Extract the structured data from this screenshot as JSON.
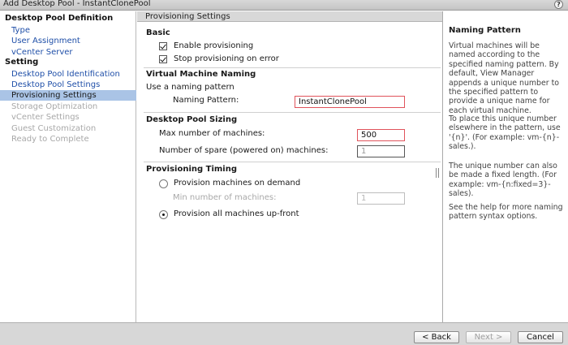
{
  "window": {
    "title": "Add Desktop Pool - InstantClonePool",
    "help_glyph": "?"
  },
  "sidebar": {
    "sections": [
      {
        "heading": "Desktop Pool Definition",
        "items": [
          {
            "label": "Type",
            "state": "link"
          },
          {
            "label": "User Assignment",
            "state": "link"
          },
          {
            "label": "vCenter Server",
            "state": "link"
          }
        ]
      },
      {
        "heading": "Setting",
        "items": [
          {
            "label": "Desktop Pool Identification",
            "state": "link"
          },
          {
            "label": "Desktop Pool Settings",
            "state": "link"
          },
          {
            "label": "Provisioning Settings",
            "state": "active"
          },
          {
            "label": "Storage Optimization",
            "state": "disabled"
          },
          {
            "label": "vCenter Settings",
            "state": "disabled"
          },
          {
            "label": "Guest Customization",
            "state": "disabled"
          },
          {
            "label": "Ready to Complete",
            "state": "disabled"
          }
        ]
      }
    ]
  },
  "main": {
    "header": "Provisioning Settings",
    "basic": {
      "title": "Basic",
      "enable_provisioning": {
        "label": "Enable provisioning",
        "checked": true
      },
      "stop_on_error": {
        "label": "Stop provisioning on error",
        "checked": true
      }
    },
    "naming": {
      "title": "Virtual Machine Naming",
      "use_pattern_label": "Use a naming pattern",
      "pattern_label": "Naming Pattern:",
      "pattern_value": "InstantClonePool"
    },
    "sizing": {
      "title": "Desktop Pool Sizing",
      "max_label": "Max number of machines:",
      "max_value": "500",
      "spare_label": "Number of spare (powered on) machines:",
      "spare_value": "1"
    },
    "timing": {
      "title": "Provisioning Timing",
      "on_demand_label": "Provision machines on demand",
      "min_label": "Min number of machines:",
      "min_value": "1",
      "upfront_label": "Provision all machines up-front",
      "selected": "upfront"
    }
  },
  "help": {
    "title": "Naming Pattern",
    "paragraphs": [
      "Virtual machines will be named according to the specified naming pattern. By default, View Manager appends a unique number to the specified pattern to provide a unique name for each virtual machine.",
      "To place this unique number elsewhere in the pattern, use '{n}'. (For example: vm-{n}-sales.).",
      "The unique number can also be made a fixed length. (For example: vm-{n:fixed=3}-sales).",
      "See the help for more naming pattern syntax options."
    ]
  },
  "footer": {
    "back_label": "< Back",
    "next_label": "Next >",
    "cancel_label": "Cancel"
  },
  "colors": {
    "active_nav_bg": "#aac4e6",
    "link": "#1f4fa8",
    "error_border": "#e0535b"
  }
}
